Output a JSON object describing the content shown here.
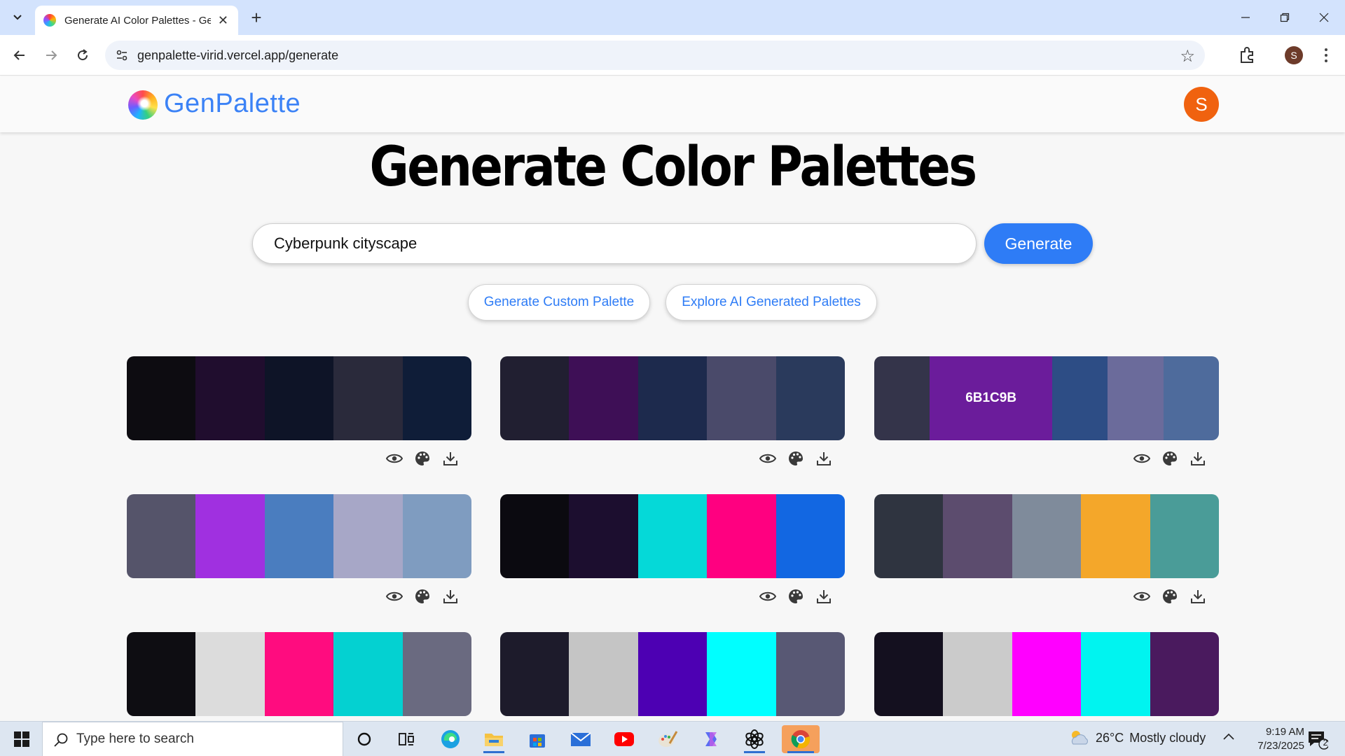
{
  "browser": {
    "tab_title": "Generate AI Color Palettes - GenPalette",
    "url": "genpalette-virid.vercel.app/generate",
    "profile_initial": "S"
  },
  "app": {
    "logo_text": "GenPalette",
    "user_initial": "S"
  },
  "main": {
    "title": "Generate Color Palettes",
    "search_value": "Cyberpunk cityscape",
    "generate_label": "Generate",
    "custom_palette_label": "Generate Custom Palette",
    "explore_label": "Explore AI Generated Palettes"
  },
  "palettes": [
    {
      "colors": [
        "#0d0c11",
        "#200d2e",
        "#0e1427",
        "#2a2a3b",
        "#0f1d38"
      ],
      "hovered": null
    },
    {
      "colors": [
        "#211f31",
        "#3e0f56",
        "#1d2a4d",
        "#4a4a6a",
        "#2a3a5c"
      ],
      "hovered": null
    },
    {
      "colors": [
        "#34344a",
        "#6b1c9b",
        "#2d4d85",
        "#6b6b9b",
        "#4e6b9c"
      ],
      "hovered": 1,
      "hover_label": "6B1C9B"
    },
    {
      "colors": [
        "#55546a",
        "#a030e0",
        "#4a7dbf",
        "#a7a7c7",
        "#7f9cc0"
      ],
      "hovered": null
    },
    {
      "colors": [
        "#0b0a10",
        "#1c0e2f",
        "#05d9d8",
        "#ff0080",
        "#1267e2"
      ],
      "hovered": null
    },
    {
      "colors": [
        "#2f3440",
        "#5c4c6e",
        "#7f8b9b",
        "#f4a72a",
        "#4a9c98"
      ],
      "hovered": null
    },
    {
      "colors": [
        "#0e0d12",
        "#dcdcdc",
        "#ff0c7f",
        "#04d1d1",
        "#6a6a80"
      ],
      "hovered": null
    },
    {
      "colors": [
        "#1d1b2b",
        "#c5c5c5",
        "#4d00b3",
        "#00ffff",
        "#585874"
      ],
      "hovered": null
    },
    {
      "colors": [
        "#14101f",
        "#cbcbcb",
        "#ff00ff",
        "#00f4f0",
        "#4a1a5e"
      ],
      "hovered": null
    }
  ],
  "taskbar": {
    "search_placeholder": "Type here to search",
    "weather_temp": "26°C",
    "weather_desc": "Mostly cloudy",
    "time": "9:19 AM",
    "date": "7/23/2025",
    "notif_count": "2"
  }
}
